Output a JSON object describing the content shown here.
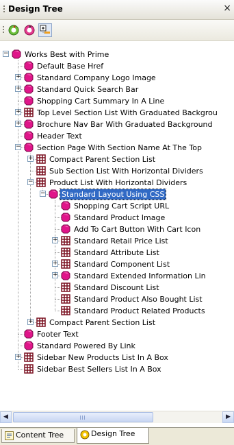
{
  "panel": {
    "title": "Design Tree",
    "close_label": "×"
  },
  "toolbar": {
    "buttons": [
      {
        "name": "refresh-prime-button",
        "icon": "green-refresh-icon"
      },
      {
        "name": "refresh-style-button",
        "icon": "pink-refresh-icon"
      },
      {
        "name": "expand-all-button",
        "icon": "expand-tree-icon"
      }
    ]
  },
  "tree": {
    "nodes": [
      {
        "label": "Works Best with Prime",
        "level": 0,
        "icon": "pink",
        "expander": "minus"
      },
      {
        "label": "Default Base Href",
        "level": 1,
        "icon": "pink",
        "expander": ""
      },
      {
        "label": "Standard Company Logo Image",
        "level": 1,
        "icon": "pink",
        "expander": "plus"
      },
      {
        "label": "Standard Quick Search Bar",
        "level": 1,
        "icon": "pink",
        "expander": "plus"
      },
      {
        "label": "Shopping Cart Summary In A Line",
        "level": 1,
        "icon": "pink",
        "expander": ""
      },
      {
        "label": "Top Level Section List With Graduated Backgrou",
        "level": 1,
        "icon": "grid",
        "expander": "plus"
      },
      {
        "label": "Brochure Nav Bar With Graduated Background",
        "level": 1,
        "icon": "pink",
        "expander": "plus"
      },
      {
        "label": "Header Text",
        "level": 1,
        "icon": "pink",
        "expander": ""
      },
      {
        "label": "Section Page With Section Name At The Top",
        "level": 1,
        "icon": "pink",
        "expander": "minus"
      },
      {
        "label": "Compact Parent Section List",
        "level": 2,
        "icon": "grid",
        "expander": "plus"
      },
      {
        "label": "Sub Section List With Horizontal Dividers",
        "level": 2,
        "icon": "grid",
        "expander": ""
      },
      {
        "label": "Product List With Horizontal Dividers",
        "level": 2,
        "icon": "grid",
        "expander": "minus"
      },
      {
        "label": "Standard Layout Using CSS",
        "level": 3,
        "icon": "pink",
        "expander": "minus",
        "selected": true
      },
      {
        "label": "Shopping Cart Script URL",
        "level": 4,
        "icon": "pink",
        "expander": ""
      },
      {
        "label": "Standard Product Image",
        "level": 4,
        "icon": "pink",
        "expander": ""
      },
      {
        "label": "Add To Cart Button With Cart Icon",
        "level": 4,
        "icon": "pink",
        "expander": ""
      },
      {
        "label": "Standard Retail Price List",
        "level": 4,
        "icon": "grid",
        "expander": "plus"
      },
      {
        "label": "Standard Attribute List",
        "level": 4,
        "icon": "grid",
        "expander": ""
      },
      {
        "label": "Standard Component List",
        "level": 4,
        "icon": "grid",
        "expander": "plus"
      },
      {
        "label": "Standard Extended Information Lin",
        "level": 4,
        "icon": "pink",
        "expander": "plus"
      },
      {
        "label": "Standard Discount List",
        "level": 4,
        "icon": "grid",
        "expander": ""
      },
      {
        "label": "Standard Product Also Bought List",
        "level": 4,
        "icon": "grid",
        "expander": ""
      },
      {
        "label": "Standard Product Related Products",
        "level": 4,
        "icon": "grid",
        "expander": ""
      },
      {
        "label": "Compact Parent Section List",
        "level": 2,
        "icon": "grid",
        "expander": "plus"
      },
      {
        "label": "Footer Text",
        "level": 1,
        "icon": "pink",
        "expander": ""
      },
      {
        "label": "Standard Powered By Link",
        "level": 1,
        "icon": "pink",
        "expander": ""
      },
      {
        "label": "Sidebar New Products List In A Box",
        "level": 1,
        "icon": "grid",
        "expander": "plus"
      },
      {
        "label": "Sidebar Best Sellers List In A Box",
        "level": 1,
        "icon": "grid",
        "expander": ""
      }
    ]
  },
  "scrollbar": {
    "left_arrow": "◀",
    "right_arrow": "▶"
  },
  "tabs": [
    {
      "label": "Content Tree",
      "icon": "content-tree-icon",
      "active": false
    },
    {
      "label": "Design Tree",
      "icon": "design-tree-icon",
      "active": true
    }
  ],
  "colors": {
    "selection": "#316ac5",
    "pink_icon": "#e0168a",
    "grid_icon": "#7a1020"
  }
}
